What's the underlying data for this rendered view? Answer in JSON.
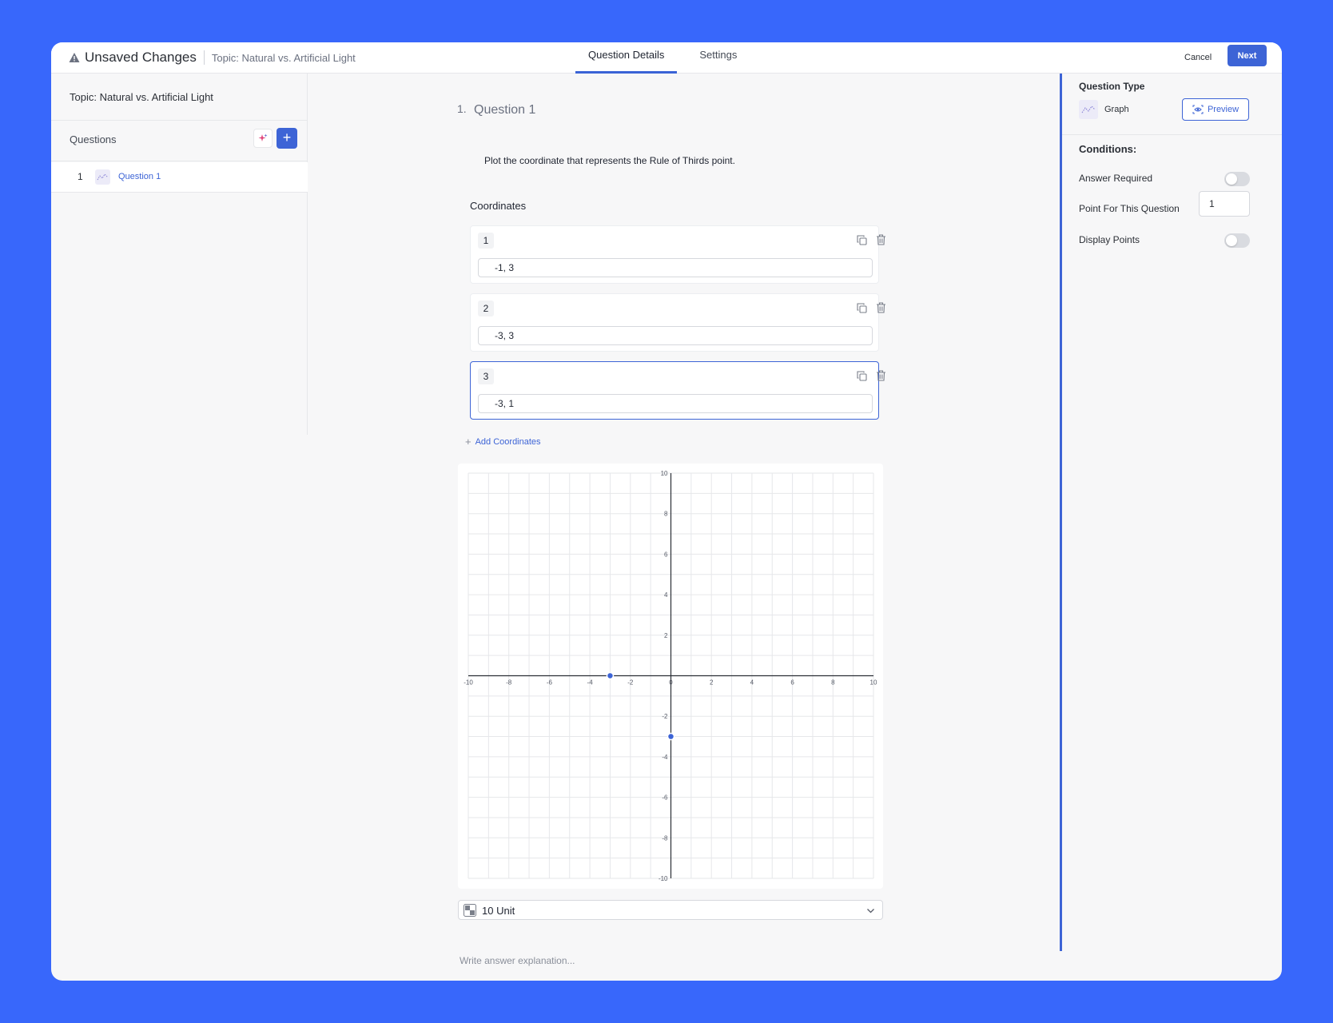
{
  "header": {
    "unsaved_label": "Unsaved Changes",
    "topic_crumb": "Topic: Natural vs. Artificial Light",
    "tabs": [
      {
        "label": "Question Details",
        "active": true
      },
      {
        "label": "Settings",
        "active": false
      }
    ],
    "cancel_label": "Cancel",
    "next_label": "Next"
  },
  "sidebar": {
    "topic": "Topic: Natural vs. Artificial Light",
    "questions_label": "Questions",
    "items": [
      {
        "number": "1",
        "label": "Question 1",
        "icon": "graph-icon"
      }
    ]
  },
  "question": {
    "index": "1.",
    "title": "Question 1",
    "prompt": "Plot the coordinate that represents the Rule of Thirds point.",
    "coordinates_heading": "Coordinates",
    "coordinates": [
      {
        "number": "1",
        "value": "-1, 3"
      },
      {
        "number": "2",
        "value": "-3, 3"
      },
      {
        "number": "3",
        "value": "-3, 1"
      }
    ],
    "add_coordinates_label": "Add Coordinates",
    "unit_select_value": "10 Unit",
    "explanation_placeholder": "Write answer explanation..."
  },
  "settings_panel": {
    "question_type_title": "Question Type",
    "question_type_value": "Graph",
    "preview_label": "Preview",
    "conditions_title": "Conditions:",
    "answer_required_label": "Answer Required",
    "answer_required": false,
    "points_label": "Point For This Question",
    "points_value": "1",
    "display_points_label": "Display Points",
    "display_points": false
  },
  "chart_data": {
    "type": "scatter",
    "xlim": [
      -10,
      10
    ],
    "ylim": [
      -10,
      10
    ],
    "x_ticks": [
      "-10",
      "-8",
      "-6",
      "-4",
      "-2",
      "0",
      "2",
      "4",
      "6",
      "8",
      "10"
    ],
    "y_ticks": [
      "10",
      "8",
      "6",
      "4",
      "2",
      "-2",
      "-4",
      "-6",
      "-8",
      "-10"
    ],
    "grid": true,
    "points": [
      {
        "x": -3,
        "y": 0
      },
      {
        "x": 0,
        "y": -3
      }
    ]
  },
  "colors": {
    "accent": "#3d64d6",
    "background": "#3867fb",
    "point": "#3d64d6"
  }
}
